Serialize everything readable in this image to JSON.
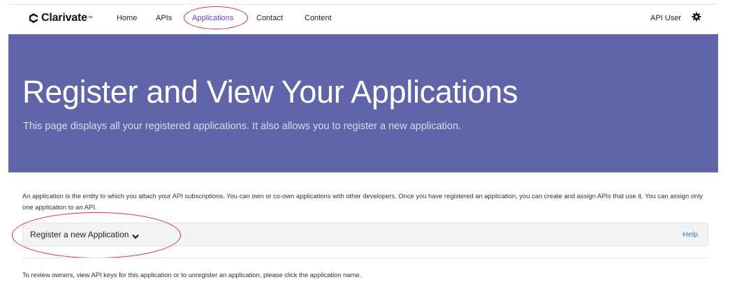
{
  "brand": {
    "name": "Clarivate",
    "tm": "™"
  },
  "nav": {
    "items": [
      {
        "label": "Home"
      },
      {
        "label": "APIs"
      },
      {
        "label": "Applications"
      },
      {
        "label": "Contact"
      },
      {
        "label": "Content"
      }
    ],
    "active": "Applications",
    "user_label": "API User",
    "settings_icon": "gear-icon"
  },
  "hero": {
    "title": "Register and View Your Applications",
    "subtitle": "This page displays all your registered applications. It also allows you to register a new application."
  },
  "content": {
    "intro": "An application is the entity to which you attach your API subscriptions. You can own or co-own applications with other developers. Once you have registered an application, you can create and assign APIs that use it. You can assign only one application to an API.",
    "register_label": "Register a new Application",
    "help_label": "Help",
    "review_text": "To review owners, view API keys for this application or to unregister an application, please click the application name."
  },
  "colors": {
    "hero_bg": "#6064a8",
    "active_nav": "#6a3fd4",
    "annotation_circle": "#e0302c",
    "link": "#2a7ad6"
  }
}
